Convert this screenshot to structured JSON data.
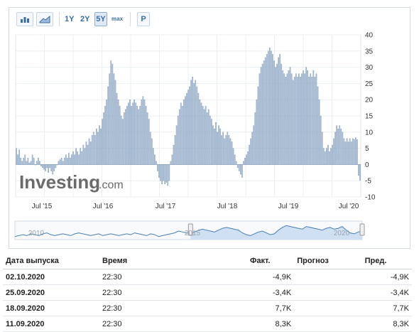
{
  "toolbar": {
    "ranges": [
      "1Y",
      "2Y",
      "5Y",
      "max"
    ],
    "selected": "5Y",
    "p_label": "P",
    "icons": [
      "bar-chart-icon",
      "area-chart-icon"
    ]
  },
  "watermark": {
    "brand": "Investing",
    "suffix": ".com"
  },
  "colors": {
    "bar_fill": "#bccbdc",
    "bar_stroke": "#7e9bbc",
    "navigator_fill": "#cfe0f2",
    "navigator_line": "#4a7fb3"
  },
  "chart_data": {
    "type": "bar",
    "x_ticks": [
      "Jul '15",
      "Jul '16",
      "Jul '17",
      "Jul '18",
      "Jul '19",
      "Jul '20"
    ],
    "ylim": [
      -10,
      40
    ],
    "y_ticks": [
      "40",
      "35",
      "30",
      "25",
      "20",
      "15",
      "10",
      "5",
      "0",
      "-5",
      "-10"
    ],
    "grid": true,
    "values": [
      5,
      3,
      4.5,
      2,
      1,
      2,
      3,
      1,
      2,
      0.5,
      1,
      3,
      2,
      0,
      1,
      2,
      1,
      -0.5,
      -1,
      -1.5,
      -2,
      -1,
      -2.5,
      -1,
      -2,
      -3,
      -2,
      -1,
      0,
      1,
      1.5,
      2,
      1,
      2,
      3,
      2,
      3.5,
      2,
      3,
      4,
      3,
      5,
      4,
      3,
      5,
      4,
      6,
      5,
      7,
      6,
      8,
      7,
      9,
      10,
      9,
      11,
      10,
      12,
      11,
      14,
      16,
      18,
      20,
      24,
      28,
      32,
      31,
      28,
      26,
      22,
      20,
      18,
      15,
      14,
      16,
      17,
      18,
      19,
      20,
      18,
      19,
      20,
      19,
      18,
      17,
      18,
      20,
      21,
      20,
      18,
      16,
      14,
      10,
      8,
      5,
      3,
      1,
      -2,
      -4,
      -5,
      -6,
      -5,
      -6,
      -5.5,
      -6.5,
      -5,
      1,
      3,
      6,
      9,
      12,
      15,
      17,
      19,
      18,
      20,
      21,
      22,
      23,
      24,
      26,
      27,
      25,
      26,
      24,
      22,
      20,
      19,
      18,
      17,
      18,
      16,
      17,
      15,
      14,
      12,
      11,
      13,
      10,
      12,
      11,
      9,
      10,
      8,
      9,
      10,
      9,
      8,
      7,
      5,
      3,
      1,
      -1,
      -2,
      -3,
      -4,
      1,
      2,
      3,
      4,
      6,
      8,
      10,
      12,
      16,
      20,
      24,
      28,
      30,
      31,
      32,
      33,
      34,
      35,
      36,
      35,
      34,
      32,
      30,
      31,
      33,
      34,
      31,
      29,
      28,
      27,
      28,
      29,
      30,
      28,
      26,
      27,
      28,
      27,
      28,
      27,
      28,
      29,
      28,
      30,
      29,
      27,
      28,
      27,
      29,
      27,
      28,
      24,
      20,
      15,
      10,
      5,
      4,
      5,
      6,
      4,
      5,
      6,
      8,
      10,
      12,
      11,
      12,
      11,
      10,
      8,
      7,
      8,
      7,
      8,
      7,
      8,
      7.7,
      8.3,
      7.7,
      -3.4,
      -4.9
    ],
    "navigator": {
      "x_labels": [
        "2010",
        "2015",
        "2020"
      ],
      "values": [
        2,
        3,
        4,
        3,
        5,
        4,
        3,
        5,
        6,
        4,
        3,
        4,
        5,
        4,
        3,
        5,
        6,
        5,
        4,
        3,
        4,
        5,
        3,
        4,
        5,
        4,
        3,
        4,
        5,
        4,
        6,
        5,
        4,
        3,
        5,
        4,
        2,
        3,
        4,
        5,
        6,
        8,
        7,
        6,
        5,
        7,
        9,
        10,
        9,
        8,
        7,
        9,
        11,
        12,
        11,
        10,
        9,
        6,
        4,
        3,
        5,
        7,
        8,
        6,
        4,
        5,
        9,
        12,
        14,
        13,
        12,
        11,
        10,
        13,
        12,
        11,
        10,
        9,
        11,
        12,
        10,
        11,
        13,
        9,
        6,
        5,
        7,
        8
      ]
    }
  },
  "table": {
    "headers": {
      "date": "Дата выпуска",
      "time": "Время",
      "actual": "Факт.",
      "forecast": "Прогноз",
      "previous": "Пред."
    },
    "rows": [
      {
        "date": "02.10.2020",
        "time": "22:30",
        "actual": "-4,9K",
        "forecast": "",
        "previous": "-4,9K"
      },
      {
        "date": "25.09.2020",
        "time": "22:30",
        "actual": "-3,4K",
        "forecast": "",
        "previous": "-3,4K"
      },
      {
        "date": "18.09.2020",
        "time": "22:30",
        "actual": "7,7K",
        "forecast": "",
        "previous": "7,7K"
      },
      {
        "date": "11.09.2020",
        "time": "22:30",
        "actual": "8,3K",
        "forecast": "",
        "previous": "8,3K"
      }
    ]
  }
}
